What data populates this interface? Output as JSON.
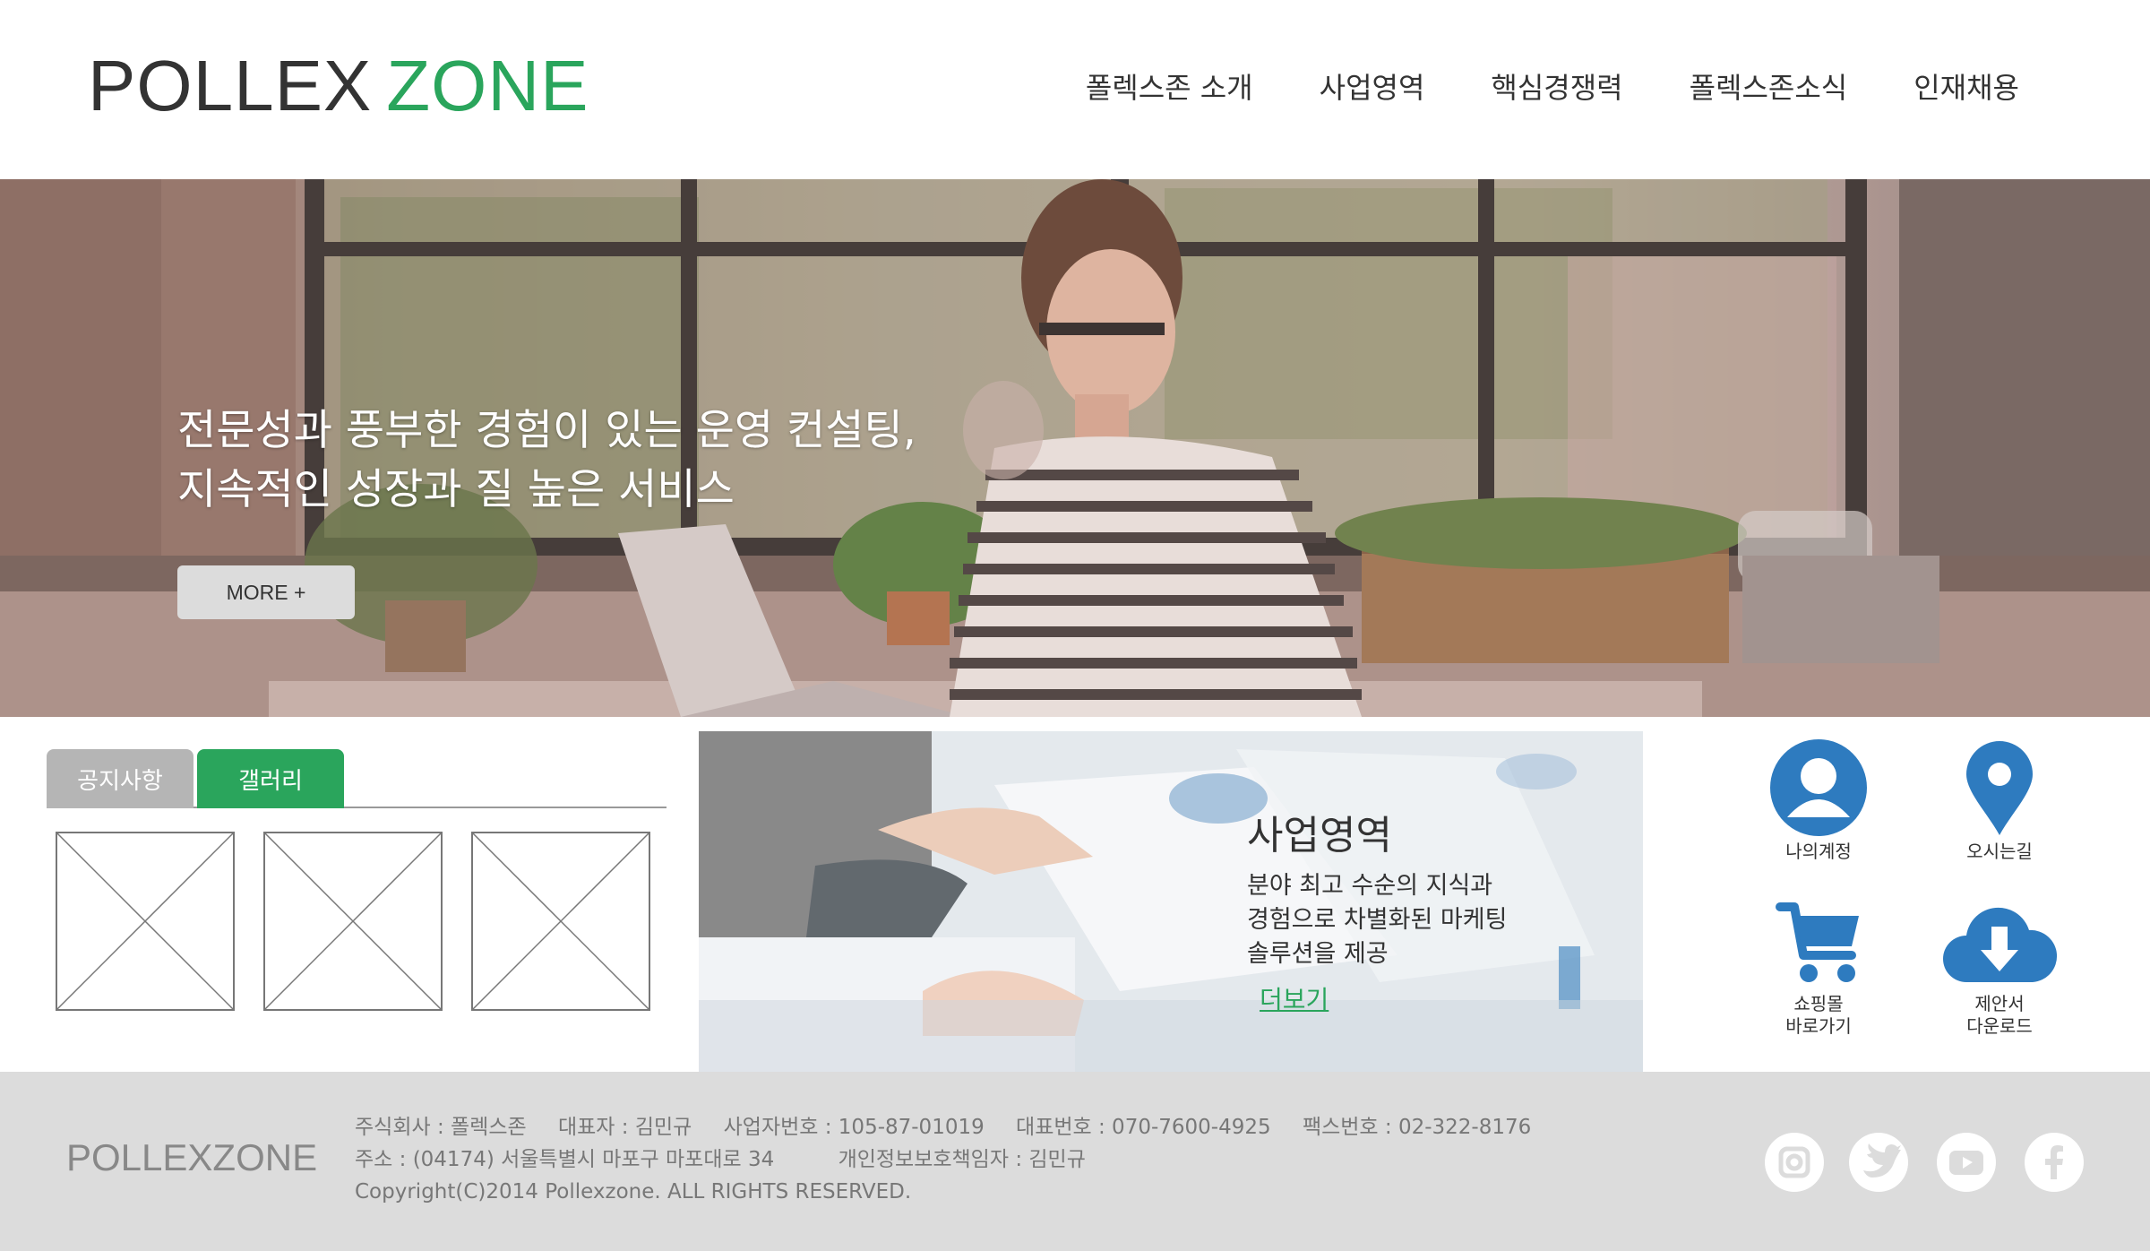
{
  "header": {
    "logo_part1": "POLLEX",
    "logo_part2": "ZONE",
    "nav": [
      "폴렉스존 소개",
      "사업영역",
      "핵심경쟁력",
      "폴렉스존소식",
      "인재채용"
    ]
  },
  "hero": {
    "line1": "전문성과 풍부한 경험이 있는 운영 컨설팅,",
    "line2": "지속적인 성장과 질 높은 서비스",
    "more_label": "MORE +"
  },
  "tabs": {
    "notice_label": "공지사항",
    "gallery_label": "갤러리"
  },
  "business": {
    "title": "사업영역",
    "desc1": "분야 최고 수순의 지식과",
    "desc2": "경험으로 차별화된 마케팅",
    "desc3": "솔루션을 제공",
    "more_label": "더보기"
  },
  "quick_menu": {
    "account": "나의계정",
    "directions": "오시는길",
    "shop_line1": "쇼핑몰",
    "shop_line2": "바로가기",
    "download_line1": "제안서",
    "download_line2": "다운로드",
    "icon_color": "#2e7bbf"
  },
  "footer": {
    "logo": "POLLEXZONE",
    "company": "주식회사 : 폴렉스존",
    "ceo": "대표자 : 김민규",
    "biz_no": "사업자번호 : 105-87-01019",
    "phone": "대표번호 : 070-7600-4925",
    "fax": "팩스번호 : 02-322-8176",
    "address": "주소 : (04174) 서울특별시 마포구 마포대로 34",
    "privacy": "개인정보보호책임자 : 김민규",
    "copyright": "Copyright(C)2014 Pollexzone. ALL RIGHTS RESERVED.",
    "social_icons": [
      "instagram-icon",
      "twitter-icon",
      "youtube-icon",
      "facebook-icon"
    ]
  },
  "colors": {
    "accent": "#2aa55c",
    "footer_bg": "#dcdcdc",
    "tab_inactive": "#b5b5b5"
  }
}
